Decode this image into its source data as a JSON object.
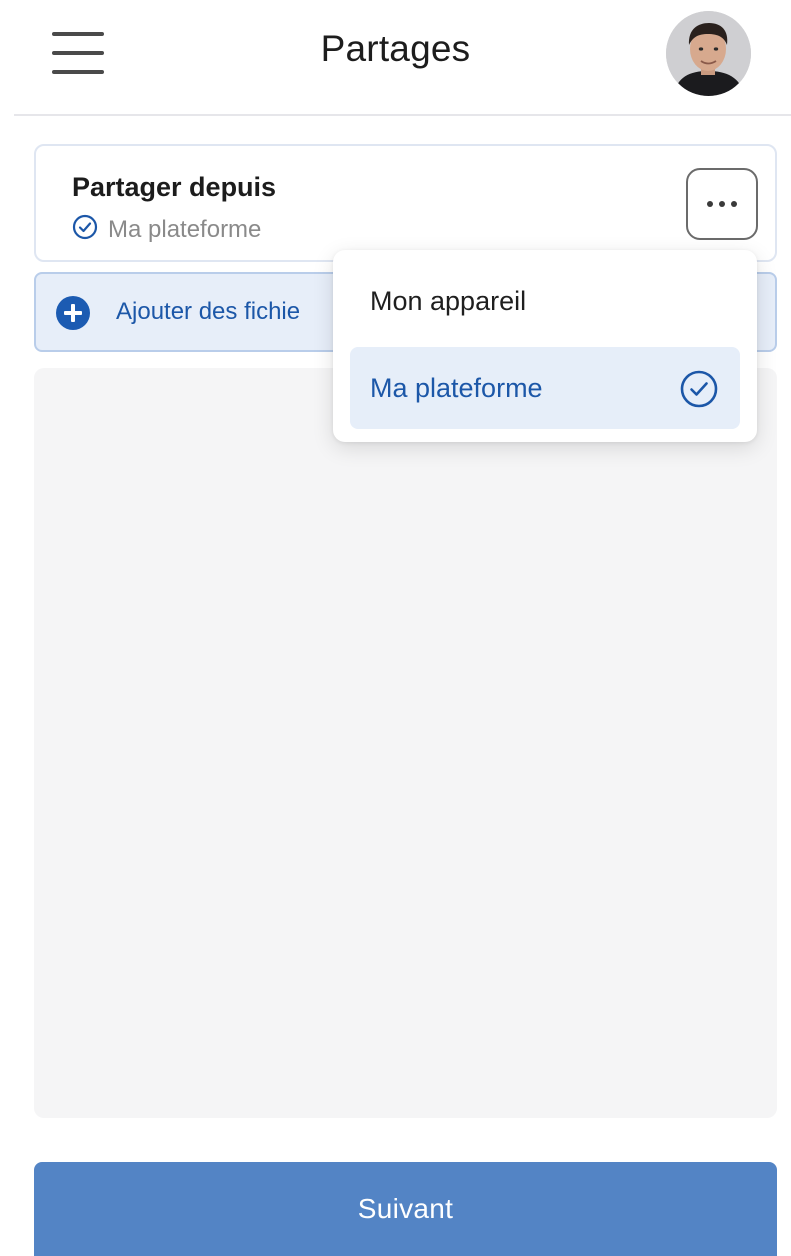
{
  "header": {
    "title": "Partages",
    "menu_icon": "hamburger-menu-icon",
    "avatar": "user-avatar"
  },
  "source": {
    "title": "Partager depuis",
    "selected": "Ma plateforme",
    "check_icon": "check-circle-icon",
    "more_icon": "more-horizontal-icon"
  },
  "add_files": {
    "label": "Ajouter des fichie",
    "icon": "plus-circle-icon"
  },
  "dropdown": {
    "items": [
      {
        "label": "Mon appareil",
        "selected": false
      },
      {
        "label": "Ma plateforme",
        "selected": true
      }
    ]
  },
  "footer": {
    "next_label": "Suivant"
  },
  "colors": {
    "accent": "#1c57a8",
    "accent_light": "#e6eef9",
    "button": "#5384c5",
    "drop_area": "#f5f5f6"
  }
}
